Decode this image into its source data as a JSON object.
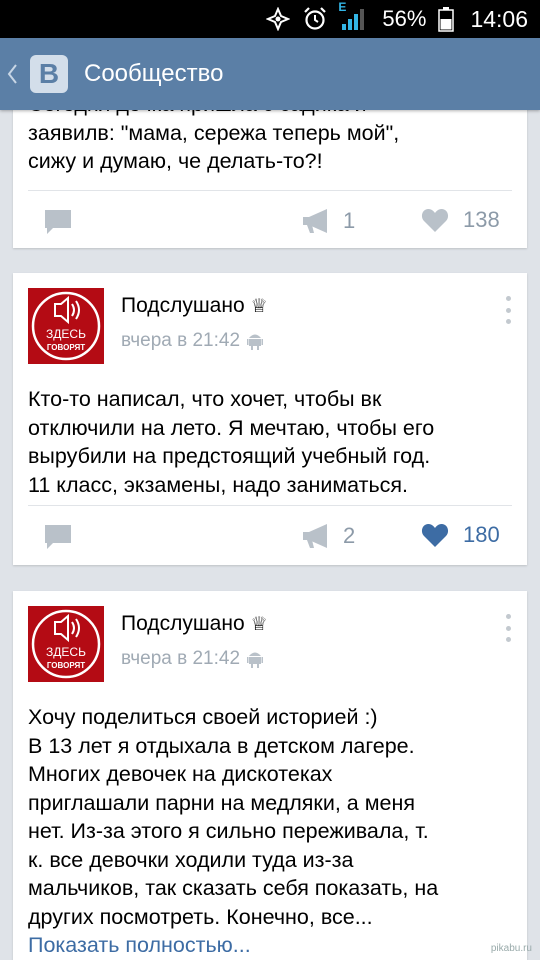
{
  "status_bar": {
    "battery_percent": "56%",
    "time": "14:06",
    "network": "E"
  },
  "header": {
    "logo_letter": "B",
    "title": "Сообщество"
  },
  "posts": [
    {
      "text_partial": "Сегодня дочка пришла с садика и\nзаявилв: \"мама, сережа теперь мой\",\nсижу и думаю, че делать-то?!",
      "reposts": "1",
      "likes": "138",
      "liked": false
    },
    {
      "author": "Подслушано",
      "crown": "♕",
      "time": "вчера в 21:42",
      "avatar_text_top": "ЗДЕСЬ",
      "avatar_text_bottom": "ГОВОРЯТ",
      "text": "Кто-то написал, что хочет, чтобы вк\nотключили на лето. Я мечтаю, чтобы его\nвырубили на предстоящий учебный год.\n11 класс, экзамены, надо заниматься.",
      "reposts": "2",
      "likes": "180",
      "liked": true
    },
    {
      "author": "Подслушано",
      "crown": "♕",
      "time": "вчера в 21:42",
      "avatar_text_top": "ЗДЕСЬ",
      "avatar_text_bottom": "ГОВОРЯТ",
      "text": "Хочу поделиться своей историей :)\nВ 13 лет я отдыхала в детском лагере.\nМногих девочек на дискотеках\nприглашали парни на медляки, а меня\nнет. Из-за этого я сильно переживала, т.\nк. все девочки ходили туда из-за\nмальчиков, так сказать себя показать, на\nдругих посмотреть. Конечно, все...",
      "show_more": "Показать полностью..."
    }
  ],
  "watermark": "pikabu.ru",
  "colors": {
    "header_bg": "#5b7fa6",
    "accent_blue": "#3d6ca4",
    "icon_gray": "#b9c1c9",
    "avatar_red": "#b40b14"
  }
}
